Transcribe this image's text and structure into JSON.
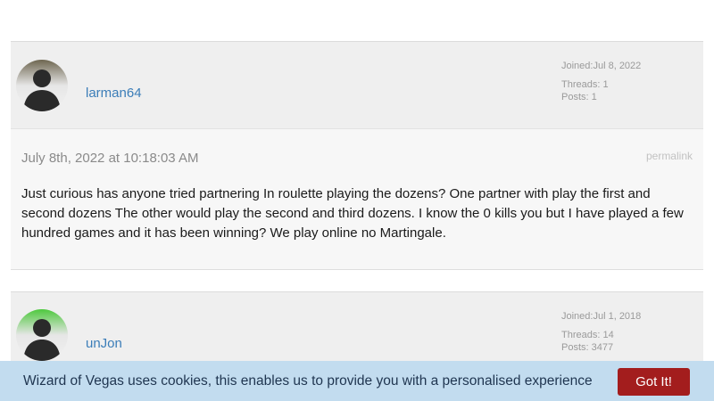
{
  "posts": [
    {
      "username": "larman64",
      "joined": "Joined:Jul 8, 2022",
      "threads": "Threads: 1",
      "posts": "Posts: 1",
      "date": "July 8th, 2022 at 10:18:03 AM",
      "permalink": "permalink",
      "body": "Just curious has anyone tried partnering In roulette playing the dozens? One partner with play the first and second dozens The other would play the second and third dozens. I know the 0 kills you but I have played a few hundred games and it has been winning? We play online no Martingale.",
      "avatar_ring_color": "#8a7a55"
    },
    {
      "username": "unJon",
      "joined": "Joined:Jul 1, 2018",
      "threads": "Threads: 14",
      "posts": "Posts: 3477",
      "avatar_ring_color": "#5ccf4d"
    }
  ],
  "cookie": {
    "text": "Wizard of Vegas uses cookies, this enables us to provide you with a personalised experience",
    "button_label": "Got It!"
  },
  "colors": {
    "link": "#3b7db8",
    "cookie_bg": "#c2dcef",
    "button_bg": "#a31d1d"
  }
}
